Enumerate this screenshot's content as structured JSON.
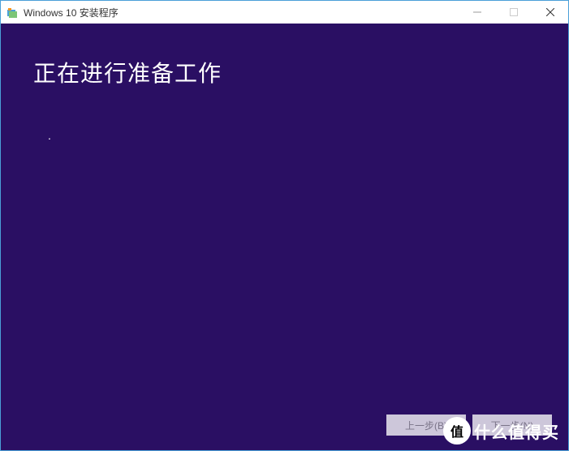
{
  "titlebar": {
    "title": "Windows 10 安装程序"
  },
  "content": {
    "heading": "正在进行准备工作",
    "progress_indicator": "."
  },
  "buttons": {
    "back": "上一步(B)",
    "next": "下一步(N)"
  },
  "watermark": {
    "badge": "值",
    "text": "什么值得买"
  }
}
